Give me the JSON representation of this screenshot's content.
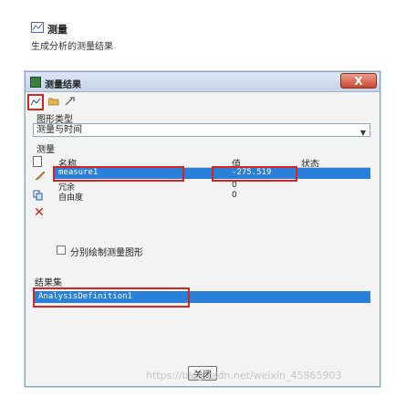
{
  "caption": {
    "title": "测量",
    "description": "生成分析的测量结果"
  },
  "dialog": {
    "title": "测量结果",
    "close_x": "X",
    "graph_type_label": "图形类型",
    "graph_type_value": "测量与时间",
    "measure_label": "测量",
    "columns": {
      "name": "名称",
      "value": "值",
      "state": "状态"
    },
    "rows": [
      {
        "name": "measure1",
        "value": "-275.519",
        "state": ""
      },
      {
        "name": "冗余",
        "value": "0",
        "state": ""
      },
      {
        "name": "自由度",
        "value": "0",
        "state": ""
      }
    ],
    "separate_plots_label": "分别绘制测量图形",
    "results_label": "结果集",
    "results_items": [
      "AnalysisDefinition1"
    ],
    "close_button": "关闭"
  },
  "watermark": "https://blog.csdn.net/weixin_45865903",
  "colors": {
    "selection": "#2a7fd9",
    "highlight_box": "#d9231e",
    "close_x": "#c9472f"
  }
}
